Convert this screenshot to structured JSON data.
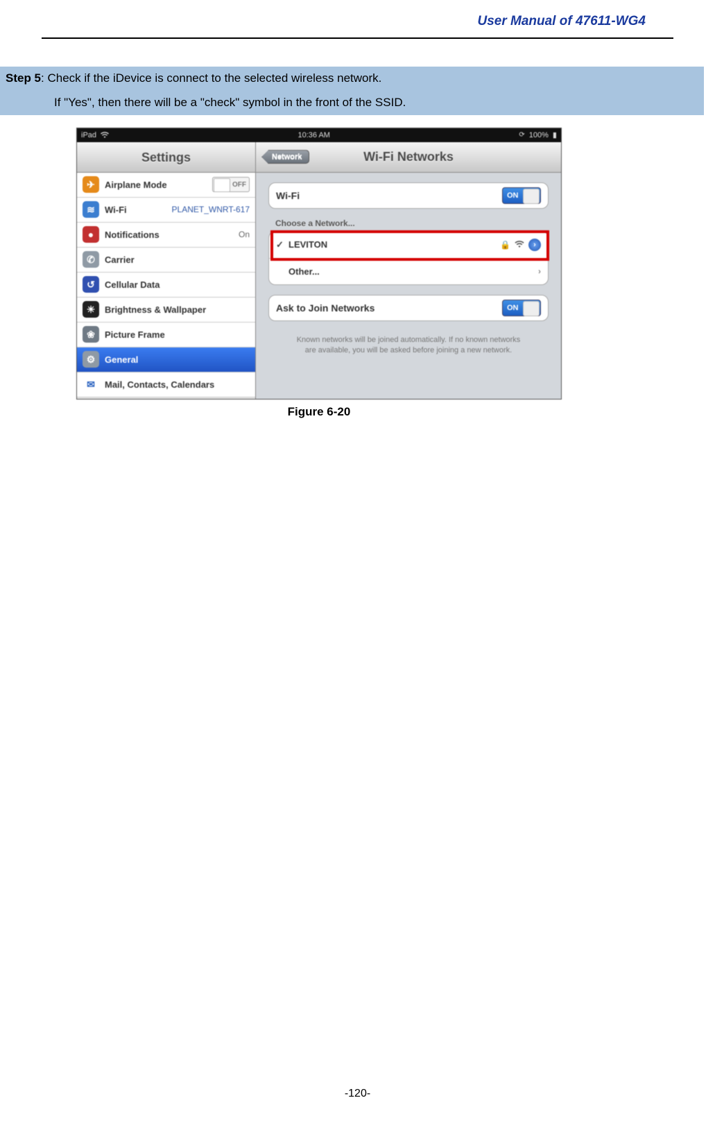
{
  "header": {
    "title": "User Manual of 47611-WG4"
  },
  "step": {
    "label": "Step 5",
    "line1_rest": ": Check if the iDevice is connect to the selected wireless network.",
    "line2": "If \"Yes\", then there will be a \"check\" symbol in the front of the SSID."
  },
  "ipad": {
    "status": {
      "device": "iPad",
      "time": "10:36 AM",
      "battery": "100%"
    },
    "left": {
      "title": "Settings",
      "items": [
        {
          "icon_bg": "#e58a1a",
          "icon_glyph": "✈",
          "label": "Airplane Mode",
          "accessory": "off_toggle",
          "off_label": "OFF"
        },
        {
          "icon_bg": "#3b7ed0",
          "icon_glyph": "≋",
          "label": "Wi-Fi",
          "accessory": "value_blue",
          "value": "PLANET_WNRT-617"
        },
        {
          "icon_bg": "#c23030",
          "icon_glyph": "●",
          "label": "Notifications",
          "accessory": "value_gray",
          "value": "On"
        },
        {
          "icon_bg": "#8f9aa5",
          "icon_glyph": "✆",
          "label": "Carrier",
          "accessory": "none"
        },
        {
          "icon_bg": "#3050b0",
          "icon_glyph": "↺",
          "label": "Cellular Data",
          "accessory": "none"
        },
        {
          "icon_bg": "#222",
          "icon_glyph": "☀",
          "label": "Brightness & Wallpaper",
          "accessory": "none"
        },
        {
          "icon_bg": "#6f7a85",
          "icon_glyph": "❀",
          "label": "Picture Frame",
          "accessory": "none"
        },
        {
          "icon_bg": "#8f9aa5",
          "icon_glyph": "⚙",
          "label": "General",
          "accessory": "none",
          "selected": true
        },
        {
          "icon_bg": "#ffffff",
          "icon_glyph": "✉",
          "icon_color": "#2a62c0",
          "label": "Mail, Contacts, Calendars",
          "accessory": "none"
        }
      ]
    },
    "right": {
      "back": "Network",
      "title": "Wi-Fi Networks",
      "wifi_label": "Wi-Fi",
      "wifi_on": "ON",
      "choose_label": "Choose a Network...",
      "network_name": "LEVITON",
      "other_label": "Other...",
      "ask_label": "Ask to Join Networks",
      "ask_on": "ON",
      "desc": "Known networks will be joined automatically. If no known networks are available, you will be asked before joining a new network."
    }
  },
  "figure": {
    "caption": "Figure 6-20"
  },
  "footer": {
    "page": "-120-"
  }
}
